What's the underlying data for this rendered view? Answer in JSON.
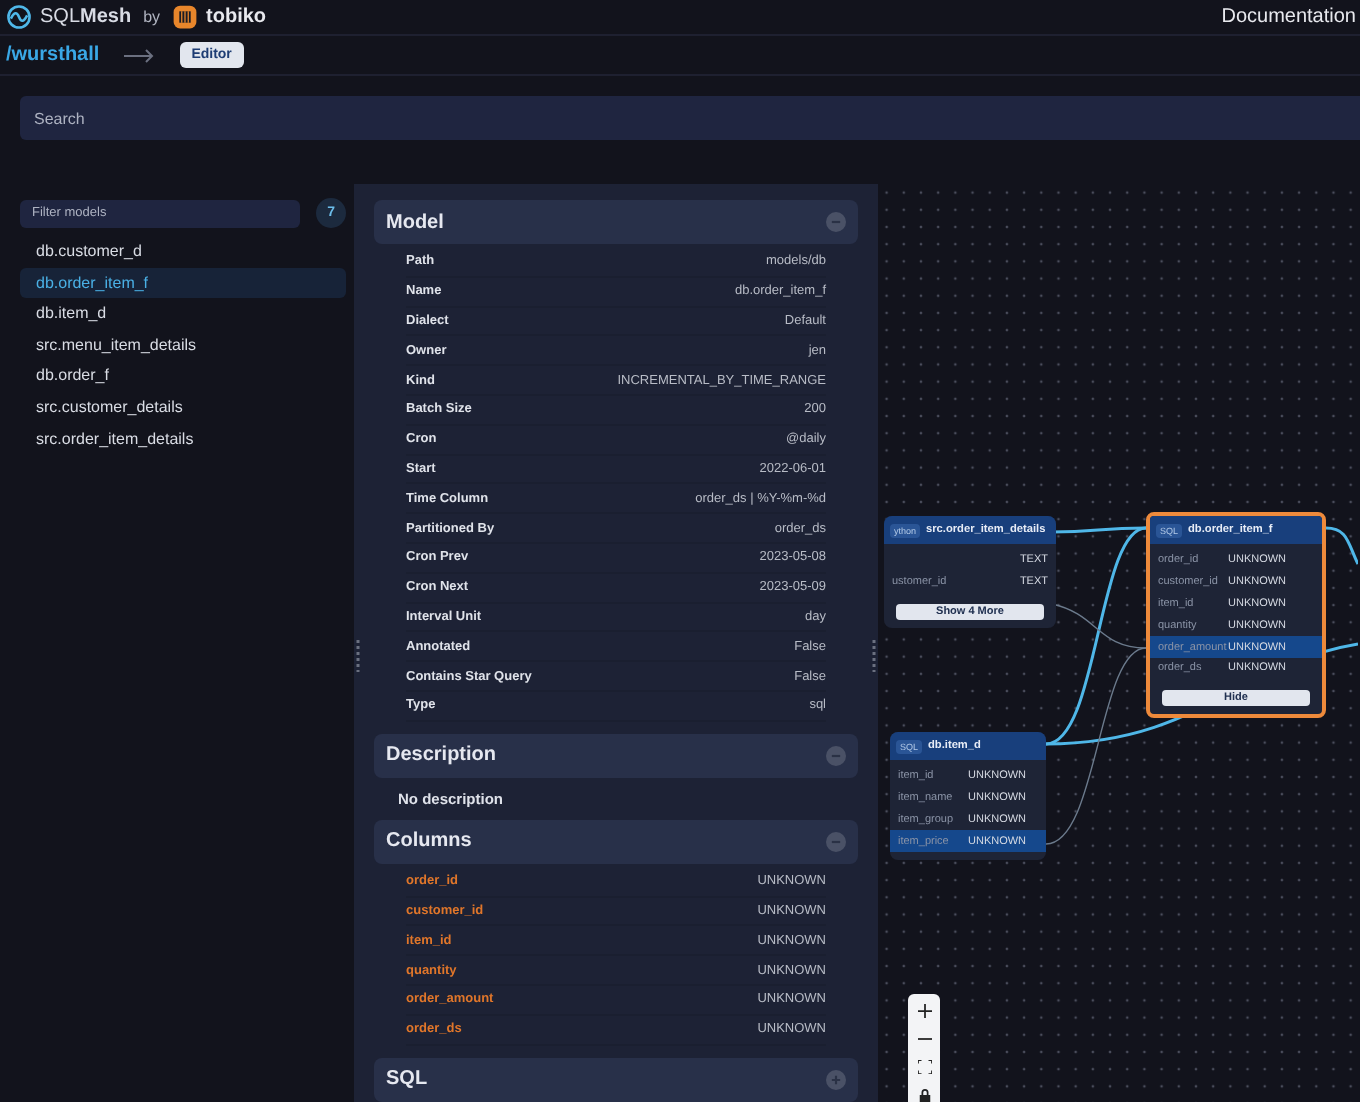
{
  "header": {
    "brand_sql": "SQL",
    "brand_mesh": "Mesh",
    "by": "by",
    "company": "tobiko",
    "docs_link": "Documentation"
  },
  "breadcrumb": {
    "project": "/wursthall",
    "mode_button": "Editor"
  },
  "search": {
    "placeholder": "Search"
  },
  "sidebar": {
    "filter_placeholder": "Filter models",
    "count": "7",
    "items": [
      {
        "label": "db.customer_d",
        "selected": false
      },
      {
        "label": "db.order_item_f",
        "selected": true
      },
      {
        "label": "db.item_d",
        "selected": false
      },
      {
        "label": "src.menu_item_details",
        "selected": false
      },
      {
        "label": "db.order_f",
        "selected": false
      },
      {
        "label": "src.customer_details",
        "selected": false
      },
      {
        "label": "src.order_item_details",
        "selected": false
      }
    ]
  },
  "details": {
    "sections": [
      {
        "kind": "props",
        "title": "Model",
        "expanded": true,
        "rows": [
          {
            "label": "Path",
            "value": "models/db"
          },
          {
            "label": "Name",
            "value": "db.order_item_f"
          },
          {
            "label": "Dialect",
            "value": "Default"
          },
          {
            "label": "Owner",
            "value": "jen"
          },
          {
            "label": "Kind",
            "value": "INCREMENTAL_BY_TIME_RANGE"
          },
          {
            "label": "Batch Size",
            "value": "200"
          },
          {
            "label": "Cron",
            "value": "@daily"
          },
          {
            "label": "Start",
            "value": "2022-06-01"
          },
          {
            "label": "Time Column",
            "value": "order_ds | %Y-%m-%d"
          },
          {
            "label": "Partitioned By",
            "value": "order_ds"
          },
          {
            "label": "Cron Prev",
            "value": "2023-05-08"
          },
          {
            "label": "Cron Next",
            "value": "2023-05-09"
          },
          {
            "label": "Interval Unit",
            "value": "day"
          },
          {
            "label": "Annotated",
            "value": "False"
          },
          {
            "label": "Contains Star Query",
            "value": "False"
          },
          {
            "label": "Type",
            "value": "sql"
          }
        ]
      },
      {
        "kind": "text",
        "title": "Description",
        "expanded": true,
        "text": "No description"
      },
      {
        "kind": "columns",
        "title": "Columns",
        "expanded": true,
        "rows": [
          {
            "label": "order_id",
            "value": "UNKNOWN"
          },
          {
            "label": "customer_id",
            "value": "UNKNOWN"
          },
          {
            "label": "item_id",
            "value": "UNKNOWN"
          },
          {
            "label": "quantity",
            "value": "UNKNOWN"
          },
          {
            "label": "order_amount",
            "value": "UNKNOWN"
          },
          {
            "label": "order_ds",
            "value": "UNKNOWN"
          }
        ]
      },
      {
        "title": "SQL",
        "expanded": false
      }
    ]
  },
  "graph": {
    "nodes": [
      {
        "badge": "ython",
        "title": "src.order_item_details",
        "selected": false,
        "columns": [
          {
            "type": "TEXT",
            "highlighted": false
          },
          {
            "name": "ustomer_id",
            "type": "TEXT",
            "highlighted": false
          }
        ],
        "button": "Show 4 More"
      },
      {
        "badge": "SQL",
        "title": "db.order_item_f",
        "selected": true,
        "columns": [
          {
            "name": "order_id",
            "type": "UNKNOWN",
            "highlighted": false
          },
          {
            "name": "customer_id",
            "type": "UNKNOWN",
            "highlighted": false
          },
          {
            "name": "item_id",
            "type": "UNKNOWN",
            "highlighted": false
          },
          {
            "name": "quantity",
            "type": "UNKNOWN",
            "highlighted": false
          },
          {
            "name": "order_amount",
            "type": "UNKNOWN",
            "highlighted": true
          },
          {
            "name": "order_ds",
            "type": "UNKNOWN",
            "highlighted": false
          }
        ],
        "button": "Hide"
      },
      {
        "badge": "SQL",
        "title": "db.item_d",
        "selected": false,
        "columns": [
          {
            "name": "item_id",
            "type": "UNKNOWN",
            "highlighted": false
          },
          {
            "name": "item_name",
            "type": "UNKNOWN",
            "highlighted": false
          },
          {
            "name": "item_group",
            "type": "UNKNOWN",
            "highlighted": false
          },
          {
            "name": "item_price",
            "type": "UNKNOWN",
            "highlighted": true
          }
        ]
      }
    ]
  }
}
